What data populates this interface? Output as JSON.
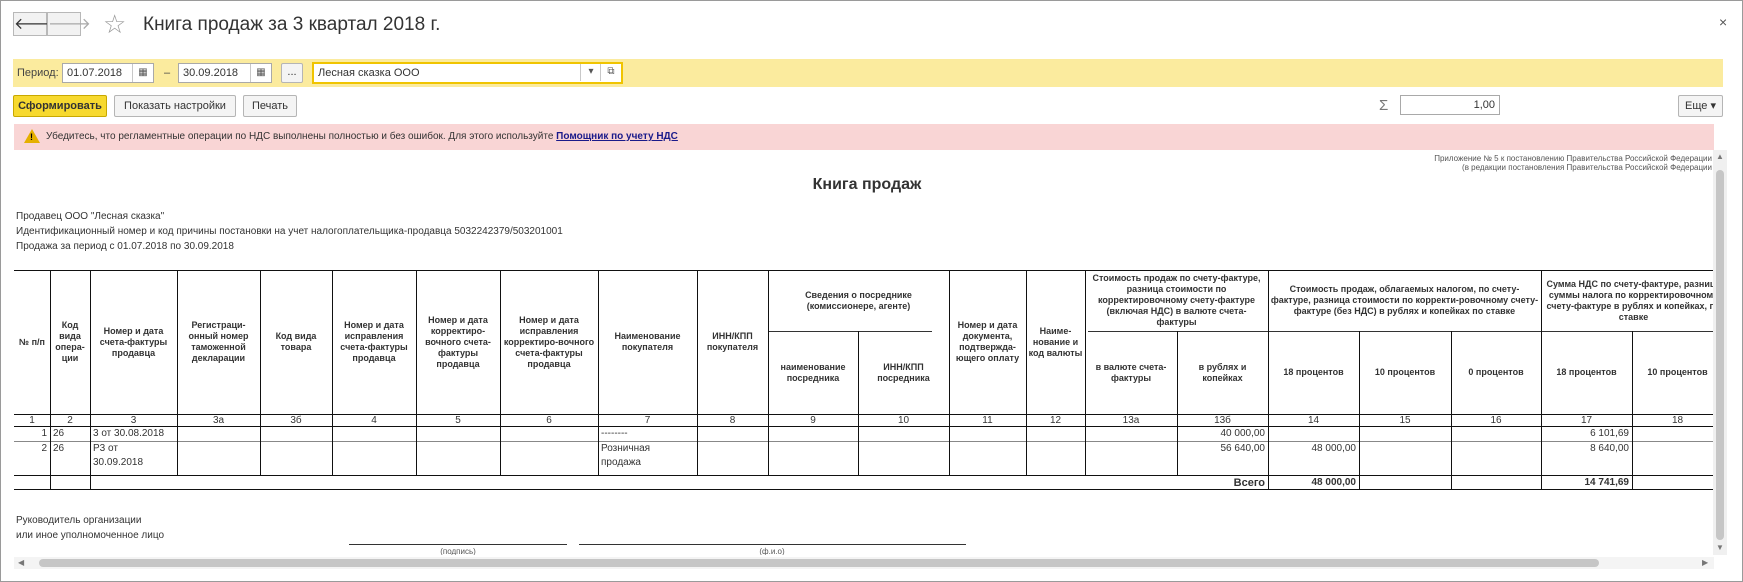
{
  "window": {
    "title": "Книга продаж за 3 квартал 2018 г.",
    "close": "×"
  },
  "nav": {
    "back": "🡐",
    "forward": "🡒",
    "star": "☆"
  },
  "params": {
    "period_label": "Период:",
    "date_from": "01.07.2018",
    "dash": "–",
    "date_to": "30.09.2018",
    "more": "...",
    "org": "Лесная сказка ООО",
    "dropdown": "▾",
    "open": "⧉",
    "cal": "▦"
  },
  "toolbar": {
    "generate": "Сформировать",
    "show_settings": "Показать настройки",
    "print": "Печать",
    "sum_symbol": "Σ",
    "sum_value": "1,00",
    "more": "Еще ▾"
  },
  "alert": {
    "icon": "!",
    "text": "Убедитесь, что регламентные операции по НДС выполнены полностью и без ошибок. Для этого используйте ",
    "link": "Помощник по учету НДС"
  },
  "report": {
    "appendix1": "Приложение № 5 к постановлению Правительства Российской Федерации",
    "appendix2": "(в редакции постановления Правительства Российской Федерации",
    "title": "Книга продаж",
    "seller": "Продавец  ООО \"Лесная сказка\"",
    "inn_line": "Идентификационный номер и код причины постановки на учет налогоплательщика-продавца  5032242379/503201001",
    "period": "Продажа за период с 01.07.2018 по 30.09.2018",
    "headers": {
      "h1": "№ п/п",
      "h2": "Код вида опера-ции",
      "h3": "Номер и дата счета-фактуры продавца",
      "h3a": "Регистраци-онный номер таможенной декларации",
      "h3b": "Код вида товара",
      "h4": "Номер и дата исправления счета-фактуры продавца",
      "h5": "Номер и дата корректиро-вочного счета-фактуры продавца",
      "h6": "Номер и дата исправления корректиро-вочного счета-фактуры продавца",
      "h7": "Наименование покупателя",
      "h8": "ИНН/КПП покупателя",
      "h9_10": "Сведения о посреднике (комиссионере, агенте)",
      "h9": "наименование посредника",
      "h10": "ИНН/КПП посредника",
      "h11": "Номер и дата документа, подтвержда-ющего оплату",
      "h12": "Наиме-нование и код валюты",
      "h13": "Стоимость продаж по счету-фактуре, разница стоимости по корректировочному счету-фактуре (включая НДС) в валюте счета-фактуры",
      "h13a": "в валюте счета-фактуры",
      "h13b": "в рублях и копейках",
      "h14_16": "Стоимость продаж, облагаемых налогом, по счету-фактуре, разница стоимости по корректи-ровочному счету-фактуре (без НДС) в рублях и копейках по ставке",
      "h14": "18 процентов",
      "h15": "10 процентов",
      "h16": "0 процентов",
      "h17_18": "Сумма НДС по счету-фактуре, разница суммы налога по корректировочному счету-фактуре в рублях и копейках, по ставке",
      "h17": "18 процентов",
      "h18": "10 процентов"
    },
    "colnums": [
      "1",
      "2",
      "3",
      "3а",
      "3б",
      "4",
      "5",
      "6",
      "7",
      "8",
      "9",
      "10",
      "11",
      "12",
      "13а",
      "13б",
      "14",
      "15",
      "16",
      "17",
      "18"
    ],
    "rows": [
      {
        "n": "1",
        "code": "26",
        "invoice": "3 от 30.08.2018",
        "buyer": "--------",
        "rub": "40 000,00",
        "base18": "",
        "vat18": "6 101,69"
      },
      {
        "n": "2",
        "code": "26",
        "invoice": "Р3 от",
        "invoice2": "30.09.2018",
        "buyer": "Розничная",
        "buyer2": "продажа",
        "rub": "56 640,00",
        "base18": "48 000,00",
        "vat18": "8 640,00"
      }
    ],
    "total_label": "Всего",
    "total_base18": "48 000,00",
    "total_vat18": "14 741,69",
    "sign1": "Руководитель организации",
    "sign2": "или иное уполномоченное лицо",
    "sign_caption": "(подпись)",
    "name_caption": "(ф.и.о)"
  }
}
